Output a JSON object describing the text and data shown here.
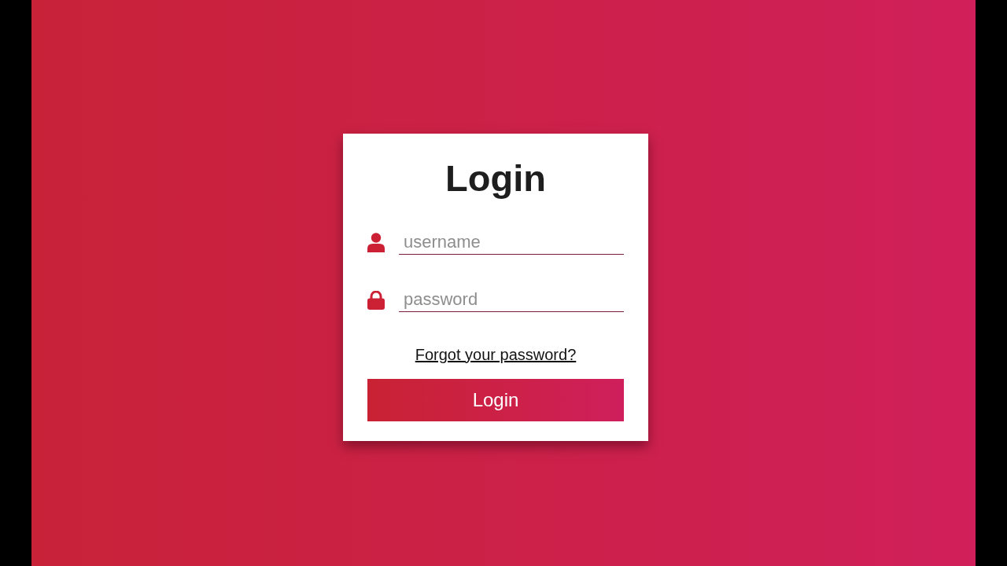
{
  "title": "Login",
  "fields": [
    {
      "kind": "user",
      "placeholder": "username"
    },
    {
      "kind": "password",
      "placeholder": "password"
    }
  ],
  "forgot_link": "Forgot your password?",
  "submit_button": "Login"
}
